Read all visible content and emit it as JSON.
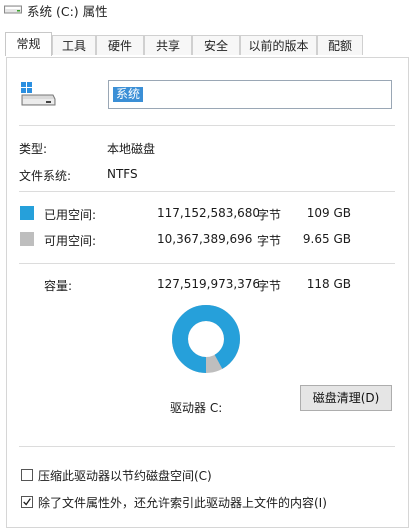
{
  "window": {
    "title": "系统 (C:) 属性",
    "icon": "drive-icon"
  },
  "tabs": [
    {
      "label": "常规",
      "active": true
    },
    {
      "label": "工具",
      "active": false
    },
    {
      "label": "硬件",
      "active": false
    },
    {
      "label": "共享",
      "active": false
    },
    {
      "label": "安全",
      "active": false
    },
    {
      "label": "以前的版本",
      "active": false
    },
    {
      "label": "配额",
      "active": false
    }
  ],
  "general": {
    "volume_name": "系统",
    "type_label": "类型:",
    "type_value": "本地磁盘",
    "fs_label": "文件系统:",
    "fs_value": "NTFS",
    "used": {
      "label": "已用空间:",
      "bytes": "117,152,583,680",
      "unit": "字节",
      "size": "109 GB",
      "color": "#26a0da"
    },
    "free": {
      "label": "可用空间:",
      "bytes": "10,367,389,696",
      "unit": "字节",
      "size": "9.65 GB",
      "color": "#bebebe"
    },
    "capacity": {
      "label": "容量:",
      "bytes": "127,519,973,376",
      "unit": "字节",
      "size": "118 GB"
    },
    "used_fraction": 0.9187,
    "drive_label": "驱动器 C:",
    "cleanup_button": "磁盘清理(D)",
    "compress_label": "压缩此驱动器以节约磁盘空间(C)",
    "compress_checked": false,
    "index_label": "除了文件属性外，还允许索引此驱动器上文件的内容(I)",
    "index_checked": true
  }
}
